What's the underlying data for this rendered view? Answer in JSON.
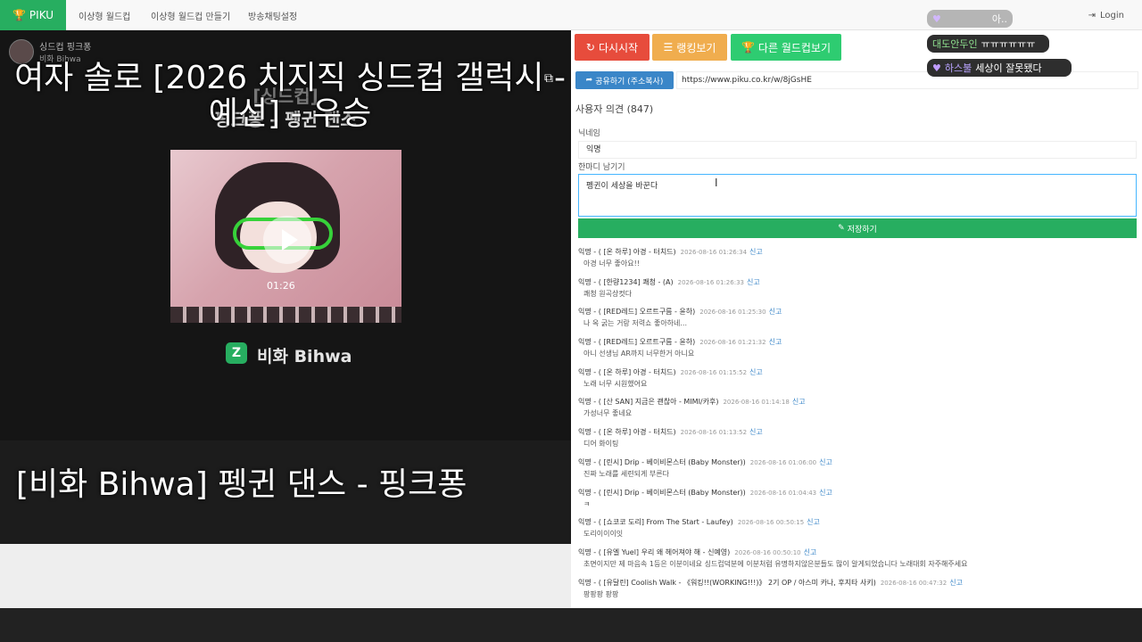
{
  "navbar": {
    "brand": "PIKU",
    "links": [
      "이상형 월드컵",
      "이상형 월드컵 만들기",
      "방송채팅설정"
    ],
    "login": "Login"
  },
  "video": {
    "channel_title": "싱드컵 핑크퐁",
    "channel_sub": "비화 Bihwa",
    "category_text": "[싱드컵]",
    "image_title": "핑크퐁 – 펭귄 댄스",
    "thumb_time": "01:26",
    "brand_name": "비화 Bihwa",
    "brand_letter": "Z",
    "overlay_title": "여자 솔로 [2026 치지직 싱드컵 갤럭시 - 예선] - 우승",
    "bottom_title": "[비화 Bihwa] 펭귄 댄스 - 핑크퐁"
  },
  "actions": {
    "restart": "다시시작",
    "ranking": "랭킹보기",
    "other": "다른 월드컵보기",
    "share": "공유하기 (주소복사)",
    "share_url": "https://www.piku.co.kr/w/8jGsHE"
  },
  "opinion": {
    "title": "사용자 의견 (847)",
    "nick_label": "닉네임",
    "nick_value": "익명",
    "comment_label": "한마디 남기기",
    "comment_value": "펭귄이 세상을 바꾼다",
    "save": "저장하기"
  },
  "comments": [
    {
      "author": "익명 - ( [온 하루] 아경 - 터치드)",
      "date": "2026-08-16 01:26:34",
      "report": "신고",
      "body": "아경 너무 좋아요!!"
    },
    {
      "author": "익명 - ( [한량1234] 쾌청 - (A)",
      "date": "2026-08-16 01:26:33",
      "report": "신고",
      "body": "쾌청 원곡상컷다"
    },
    {
      "author": "익명 - ( [RED레드] 오르트구름 - 윤하)",
      "date": "2026-08-16 01:25:30",
      "report": "신고",
      "body": "나 옥 굵는 거랑 저력쇼 좋아하네..."
    },
    {
      "author": "익명 - ( [RED레드] 오르트구름 - 윤하)",
      "date": "2026-08-16 01:21:32",
      "report": "신고",
      "body": "아니 선생님 AR까지 너무한거 아니요"
    },
    {
      "author": "익명 - ( [온 하루] 아경 - 터치드)",
      "date": "2026-08-16 01:15:52",
      "report": "신고",
      "body": "노래 너무 시원했어요"
    },
    {
      "author": "익명 - ( [산 SAN] 지금은 괜찮아 - MIMI/카후)",
      "date": "2026-08-16 01:14:18",
      "report": "신고",
      "body": "가성너무 좋네요"
    },
    {
      "author": "익명 - ( [온 하루] 아경 - 터치드)",
      "date": "2026-08-16 01:13:52",
      "report": "신고",
      "body": "디어 화이팅"
    },
    {
      "author": "익명 - ( [린시] Drip - 베이비몬스터 (Baby Monster))",
      "date": "2026-08-16 01:06:00",
      "report": "신고",
      "body": "진짜 노래를 세련되게 부른다"
    },
    {
      "author": "익명 - ( [린시] Drip - 베이비몬스터 (Baby Monster))",
      "date": "2026-08-16 01:04:43",
      "report": "신고",
      "body": "ㅋ"
    },
    {
      "author": "익명 - ( [쇼코코 도리] From The Start - Laufey)",
      "date": "2026-08-16 00:50:15",
      "report": "신고",
      "body": "도리이이이잇"
    },
    {
      "author": "익명 - ( [유엘 Yuel] 우리 왜 헤어져야 해 - 신예영)",
      "date": "2026-08-16 00:50:10",
      "report": "신고",
      "body": "초면이지만 제 마음속 1등은 이분이네요 싱드컵덕분에 이분처럼 유명하지않은분들도 많이 알게되었습니다 노래대회 자주해주세요"
    },
    {
      "author": "익명 - ( [유달린] Coolish Walk - 《워킹!!(WORKING!!!)》 2기 OP / 아스미 카나, 후지타 사키)",
      "date": "2026-08-16 00:47:32",
      "report": "신고",
      "body": "팡팡팡 팡팡"
    }
  ],
  "chat_popups": [
    {
      "name": "",
      "message": "아.."
    },
    {
      "name": "대도안두인",
      "message": "ㅠㅠㅠㅠㅠㅠ"
    },
    {
      "name": "하스불",
      "message": "세상이 잘못됐다"
    }
  ],
  "colors": {
    "brand_green": "#27ae60",
    "red": "#e74c3c",
    "orange": "#f0ad4e",
    "green": "#2ecc71",
    "blue": "#3a86c8"
  }
}
